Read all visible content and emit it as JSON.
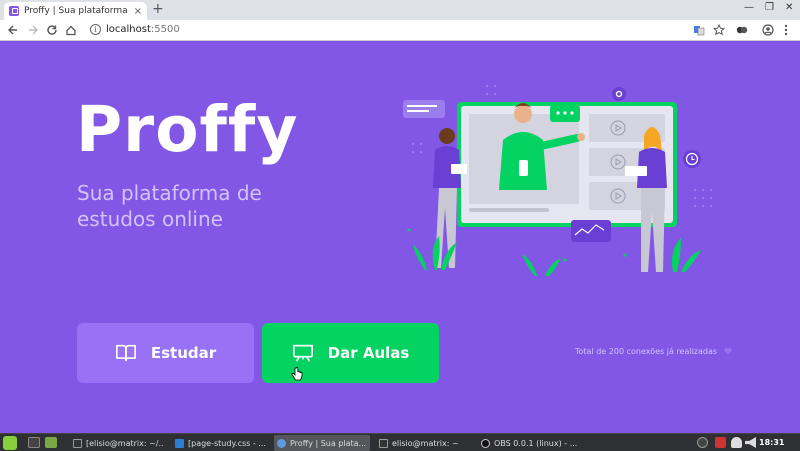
{
  "browser": {
    "tab_title": "Proffy | Sua plataforma de es",
    "tab_close": "×",
    "new_tab": "+",
    "minimize": "—",
    "maximize": "❐",
    "close": "✕",
    "url_host": "localhost",
    "url_port": ":5500",
    "back_icon": "arrow-left-icon",
    "forward_icon": "arrow-right-icon",
    "reload_icon": "reload-icon",
    "home_icon": "home-icon",
    "info_icon": "info-icon"
  },
  "page": {
    "logo": "Proffy",
    "tagline": "Sua plataforma de estudos online",
    "study_button": "Estudar",
    "teach_button": "Dar Aulas",
    "connections": "Total de 200 conexões já realizadas",
    "colors": {
      "background": "#8257e5",
      "study": "#9871f5",
      "teach": "#04d361",
      "tagline": "#d4c2ff"
    }
  },
  "taskbar": {
    "tasks": [
      "[elisio@matrix: ~/...",
      "[page-study.css - ...",
      "Proffy | Sua plata...",
      "elisio@matrix: ~",
      "OBS 0.0.1 (linux) - ..."
    ],
    "clock": "18:31"
  }
}
